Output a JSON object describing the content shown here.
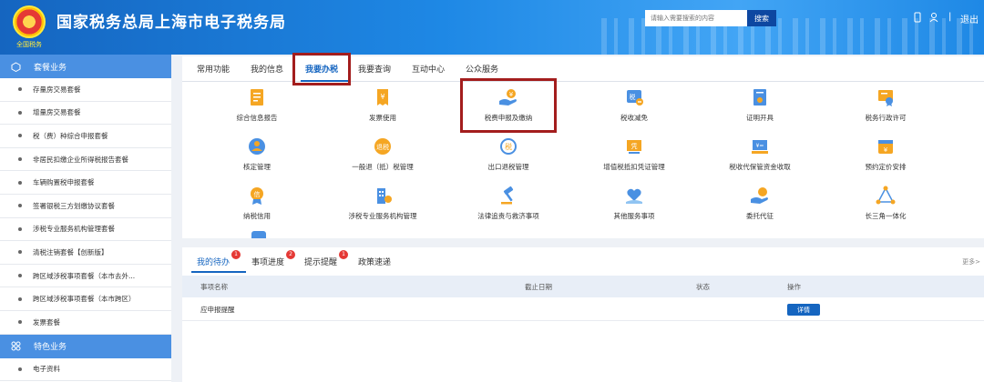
{
  "header": {
    "title": "国家税务总局上海市电子税务局",
    "emblem_text": "全国税务",
    "search_placeholder": "请输入需要搜索的内容",
    "search_button": "搜索",
    "separator": "|",
    "logout": "退出",
    "icons": [
      "phone-icon",
      "user-icon"
    ]
  },
  "sidebar": {
    "section1": "套餐业务",
    "items": [
      "存量房交易套餐",
      "增量房交易套餐",
      "税（费）种综合申报套餐",
      "非居民扣缴企业所得税报告套餐",
      "车辆购置税申报套餐",
      "签署银税三方划缴协议套餐",
      "涉税专业服务机构管理套餐",
      "清税注销套餐【创新版】",
      "跨区域涉税事项套餐（本市去外...",
      "跨区域涉税事项套餐（本市跨区）",
      "发票套餐"
    ],
    "section2": "特色业务",
    "items2": [
      "电子资料"
    ]
  },
  "tabs": [
    "常用功能",
    "我的信息",
    "我要办税",
    "我要查询",
    "互动中心",
    "公众服务"
  ],
  "active_tab": "我要办税",
  "grid": [
    {
      "label": "综合信息报告",
      "icon": "document-icon",
      "color": "#f5a623"
    },
    {
      "label": "发票使用",
      "icon": "invoice-icon",
      "color": "#f5a623"
    },
    {
      "label": "税费申报及缴纳",
      "icon": "hand-coin-icon",
      "color": "#4a90e2"
    },
    {
      "label": "税收减免",
      "icon": "tax-reduction-icon",
      "color": "#4a90e2"
    },
    {
      "label": "证明开具",
      "icon": "certificate-icon",
      "color": "#4a90e2"
    },
    {
      "label": "税务行政许可",
      "icon": "permit-icon",
      "color": "#f5a623"
    },
    {
      "label": "核定管理",
      "icon": "verify-icon",
      "color": "#f5a623"
    },
    {
      "label": "一般退（抵）税管理",
      "icon": "refund-icon",
      "color": "#f5a623"
    },
    {
      "label": "出口退税管理",
      "icon": "export-refund-icon",
      "color": "#4a90e2"
    },
    {
      "label": "增值税抵扣凭证管理",
      "icon": "voucher-icon",
      "color": "#f5a623"
    },
    {
      "label": "税收代保管资金收取",
      "icon": "custody-icon",
      "color": "#4a90e2"
    },
    {
      "label": "预约定价安排",
      "icon": "calendar-icon",
      "color": "#f5a623"
    },
    {
      "label": "纳税信用",
      "icon": "credit-icon",
      "color": "#f5a623"
    },
    {
      "label": "涉税专业服务机构管理",
      "icon": "building-icon",
      "color": "#4a90e2"
    },
    {
      "label": "法律追责与救济事项",
      "icon": "gavel-icon",
      "color": "#4a90e2"
    },
    {
      "label": "其他服务事项",
      "icon": "heart-hand-icon",
      "color": "#4a90e2"
    },
    {
      "label": "委托代征",
      "icon": "entrust-icon",
      "color": "#4a90e2"
    },
    {
      "label": "长三角一体化",
      "icon": "triangle-network-icon",
      "color": "#4a90e2"
    }
  ],
  "todo": {
    "tabs": [
      {
        "label": "我的待办",
        "badge": "1"
      },
      {
        "label": "事项进度",
        "badge": "2"
      },
      {
        "label": "提示提醒",
        "badge": "1"
      },
      {
        "label": "政策速递",
        "badge": ""
      }
    ],
    "more": "更多>",
    "columns": [
      "事项名称",
      "截止日期",
      "状态",
      "操作"
    ],
    "rows": [
      {
        "name": "应申报提醒",
        "deadline": "",
        "status": "",
        "action": "详情"
      }
    ]
  }
}
